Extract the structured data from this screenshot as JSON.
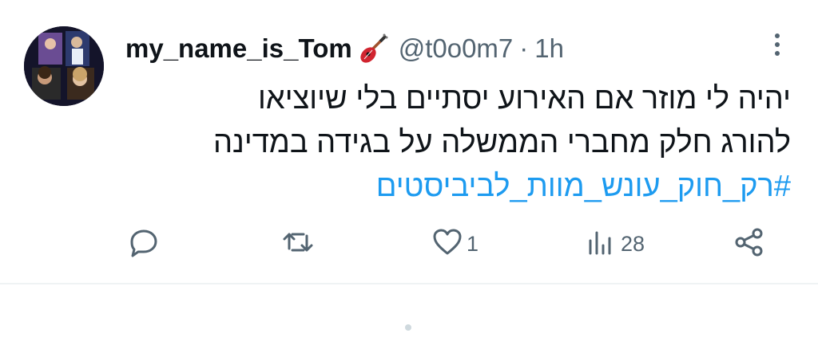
{
  "tweet": {
    "display_name": "my_name_is_Tom",
    "name_emoji": "guitar-icon",
    "handle": "@t0o0m7",
    "separator": "·",
    "time": "1h",
    "text_line1": "יהיה לי מוזר אם האירוע יסתיים בלי שיוציאו",
    "text_line2": "להורג חלק מחברי הממשלה על בגידה במדינה",
    "hashtag": "#רק_חוק_עונש_מוות_לביביסטים",
    "actions": {
      "reply_count": "",
      "retweet_count": "",
      "like_count": "1",
      "views_count": "28"
    }
  },
  "colors": {
    "text": "#0f1419",
    "secondary": "#536471",
    "link": "#1d9bf0",
    "divider": "#eff3f4"
  }
}
